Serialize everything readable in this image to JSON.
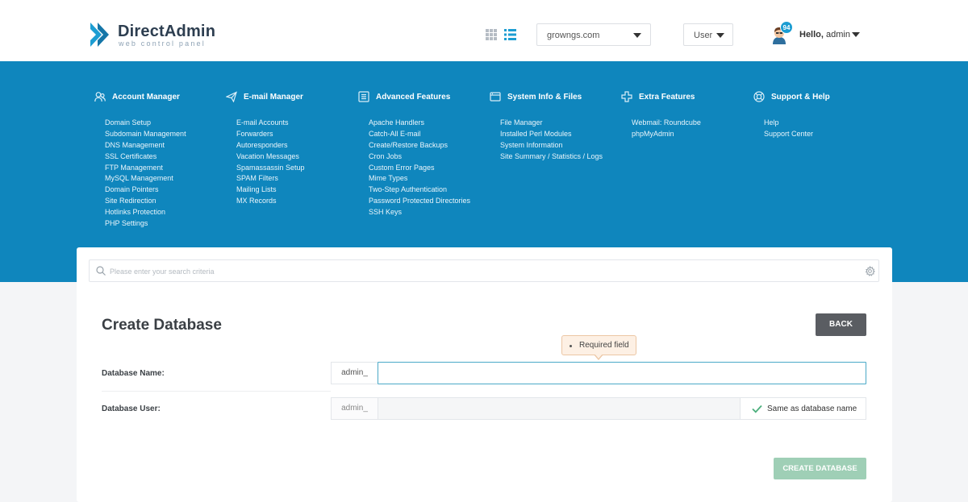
{
  "brand": {
    "name": "DirectAdmin",
    "tagline": "web control panel",
    "accent": "#1c9dd2",
    "nav_color": "#0f86bd"
  },
  "header": {
    "domain_select": {
      "value": "growngs.com"
    },
    "role_select": {
      "value": "User"
    },
    "notifications": "94",
    "greeting": "Hello,",
    "username": "admin"
  },
  "nav": {
    "columns": [
      {
        "title": "Account Manager",
        "icon": "users-icon",
        "items": [
          "Domain Setup",
          "Subdomain Management",
          "DNS Management",
          "SSL Certificates",
          "FTP Management",
          "MySQL Management",
          "Domain Pointers",
          "Site Redirection",
          "Hotlinks Protection",
          "PHP Settings"
        ]
      },
      {
        "title": "E-mail Manager",
        "icon": "paper-plane-icon",
        "items": [
          "E-mail Accounts",
          "Forwarders",
          "Autoresponders",
          "Vacation Messages",
          "Spamassassin Setup",
          "SPAM Filters",
          "Mailing Lists",
          "MX Records"
        ]
      },
      {
        "title": "Advanced Features",
        "icon": "list-icon",
        "items": [
          "Apache Handlers",
          "Catch-All E-mail",
          "Create/Restore Backups",
          "Cron Jobs",
          "Custom Error Pages",
          "Mime Types",
          "Two-Step Authentication",
          "Password Protected Directories",
          "SSH Keys"
        ]
      },
      {
        "title": "System Info & Files",
        "icon": "window-icon",
        "items": [
          "File Manager",
          "Installed Perl Modules",
          "System Information",
          "Site Summary / Statistics / Logs"
        ]
      },
      {
        "title": "Extra Features",
        "icon": "plus-icon",
        "items": [
          "Webmail: Roundcube",
          "phpMyAdmin"
        ]
      },
      {
        "title": "Support & Help",
        "icon": "lifebuoy-icon",
        "items": [
          "Help",
          "Support Center"
        ]
      }
    ]
  },
  "search": {
    "placeholder": "Please enter your search criteria"
  },
  "form": {
    "title": "Create Database",
    "back_label": "BACK",
    "tooltip": "Required field",
    "db_name": {
      "label": "Database Name:",
      "prefix": "admin_",
      "value": ""
    },
    "db_user": {
      "label": "Database User:",
      "prefix": "admin_",
      "value": "",
      "same_as_label": "Same as database name"
    },
    "submit_label": "CREATE DATABASE"
  }
}
